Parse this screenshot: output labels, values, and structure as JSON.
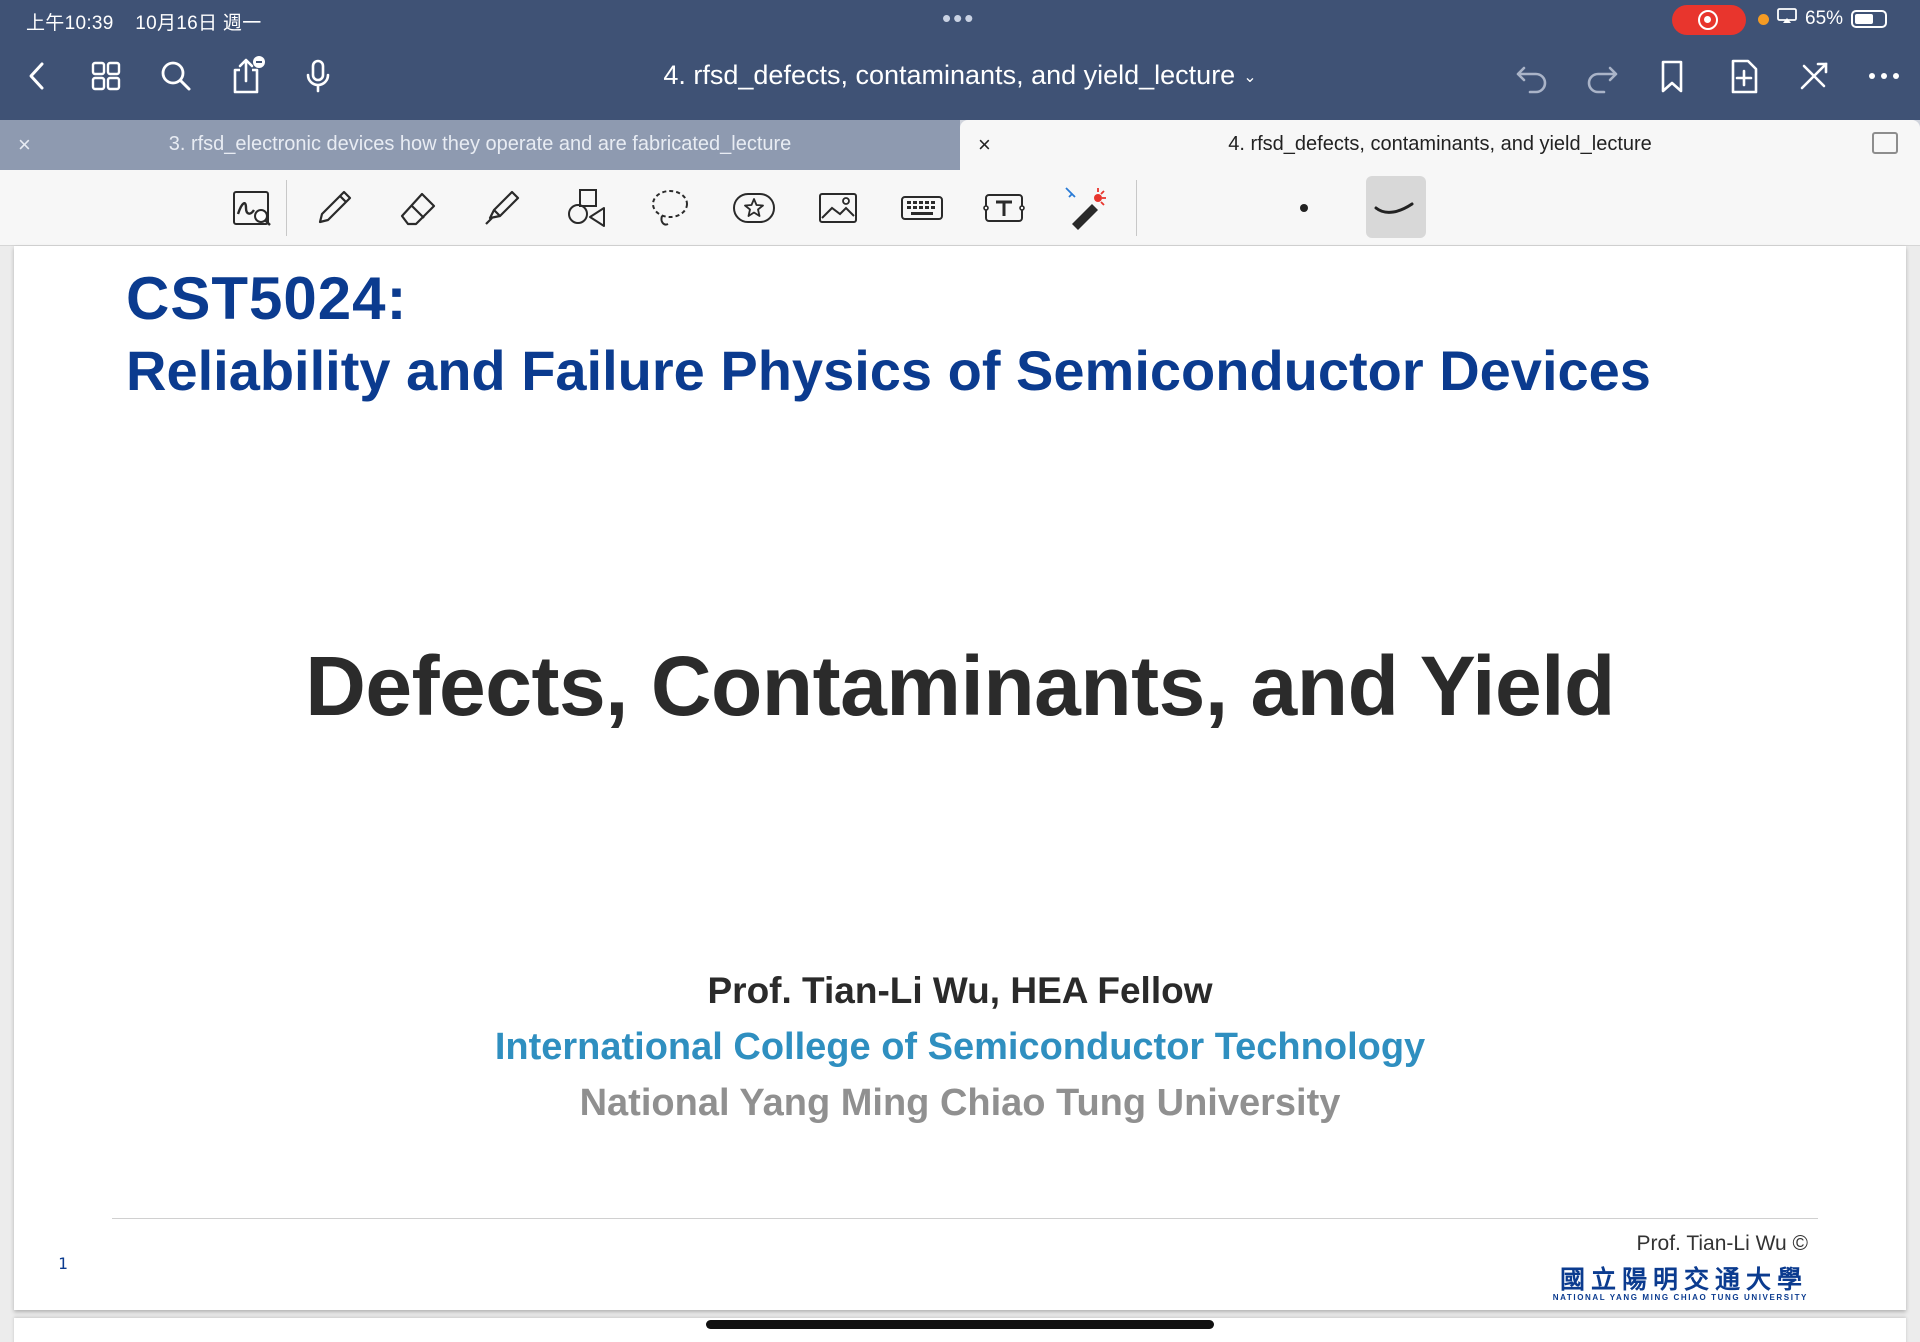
{
  "status_bar": {
    "time": "上午10:39",
    "date": "10月16日 週一",
    "battery": "65%",
    "battery_level": 0.65
  },
  "nav": {
    "title": "4. rfsd_defects, contaminants, and yield_lecture",
    "title_chevron": "⌄"
  },
  "tabs": [
    {
      "label": "3. rfsd_electronic devices how they operate and are fabricated_lecture",
      "close": "×",
      "active": false
    },
    {
      "label": "4. rfsd_defects, contaminants, and yield_lecture",
      "close": "×",
      "active": true
    }
  ],
  "slide": {
    "course_code": "CST5024:",
    "course_name": "Reliability and Failure Physics of Semiconductor Devices",
    "lecture_title": "Defects, Contaminants, and Yield",
    "author": "Prof. Tian-Li Wu, HEA Fellow",
    "college": "International College of Semiconductor Technology",
    "university": "National Yang Ming Chiao Tung University",
    "page_number": "1",
    "copyright": "Prof. Tian-Li Wu ©",
    "logo_cn": "國立陽明交通大學",
    "logo_en": "NATIONAL YANG MING CHIAO TUNG UNIVERSITY"
  },
  "colors": {
    "nav_bg": "#3f5275",
    "title_blue": "#0b3b8f",
    "college_blue": "#2f8fc0",
    "university_gray": "#909090",
    "record_red": "#e8352d"
  }
}
